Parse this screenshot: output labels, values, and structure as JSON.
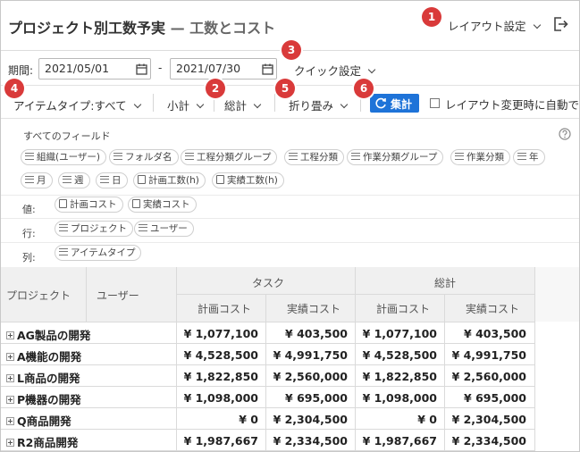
{
  "header": {
    "title": "プロジェクト別工数予実",
    "dash": "—",
    "subtitle": "工数とコスト",
    "layout_settings": "レイアウト設定"
  },
  "period": {
    "label": "期間:",
    "start": "2021/05/01",
    "separator": "-",
    "end": "2021/07/30",
    "quick_settings": "クイック設定"
  },
  "toolbar": {
    "item_type": "アイテムタイプ:すべて",
    "subtotal": "小計",
    "total": "総計",
    "fold": "折り畳み",
    "aggregate": "集計",
    "auto_label": "レイアウト変更時に自動で"
  },
  "fields": {
    "all_fields_label": "すべてのフィールド",
    "available": [
      "組織(ユーザー)",
      "フォルダ名",
      "工程分類グループ",
      "工程分類",
      "作業分類グループ",
      "作業分類",
      "年",
      "月",
      "週",
      "日",
      "計画工数(h)",
      "実績工数(h)"
    ],
    "values_label": "値:",
    "values": [
      "計画コスト",
      "実績コスト"
    ],
    "rows_label": "行:",
    "rows": [
      "プロジェクト",
      "ユーザー"
    ],
    "cols_label": "列:",
    "cols": [
      "アイテムタイプ"
    ]
  },
  "table": {
    "row_headers": [
      "プロジェクト",
      "ユーザー"
    ],
    "group_headers": [
      "タスク",
      "総計"
    ],
    "sub_headers": [
      "計画コスト",
      "実績コスト",
      "計画コスト",
      "実績コスト"
    ],
    "rows": [
      {
        "project": "AG製品の開発",
        "values": [
          "¥ 1,077,100",
          "¥ 403,500",
          "¥ 1,077,100",
          "¥ 403,500"
        ]
      },
      {
        "project": "A機能の開発",
        "values": [
          "¥ 4,528,500",
          "¥ 4,991,750",
          "¥ 4,528,500",
          "¥ 4,991,750"
        ]
      },
      {
        "project": "L商品の開発",
        "values": [
          "¥ 1,822,850",
          "¥ 2,560,000",
          "¥ 1,822,850",
          "¥ 2,560,000"
        ]
      },
      {
        "project": "P機器の開発",
        "values": [
          "¥ 1,098,000",
          "¥ 695,000",
          "¥ 1,098,000",
          "¥ 695,000"
        ]
      },
      {
        "project": "Q商品開発",
        "values": [
          "¥ 0",
          "¥ 2,304,500",
          "¥ 0",
          "¥ 2,304,500"
        ]
      },
      {
        "project": "R2商品開発",
        "values": [
          "¥ 1,987,667",
          "¥ 2,334,500",
          "¥ 1,987,667",
          "¥ 2,334,500"
        ]
      }
    ]
  },
  "callouts": [
    "1",
    "2",
    "3",
    "4",
    "5",
    "6"
  ],
  "colors": {
    "accent": "#1e73d8",
    "callout": "#d93a3a",
    "header_bg": "#f0f0f0"
  }
}
